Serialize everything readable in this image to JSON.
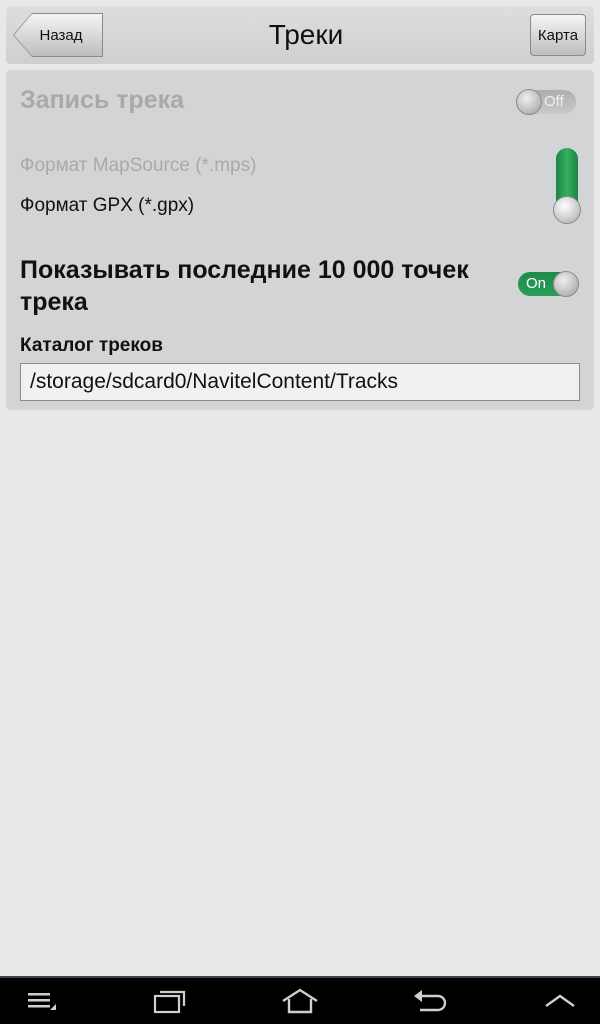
{
  "header": {
    "back_label": "Назад",
    "title": "Треки",
    "map_label": "Карта"
  },
  "settings": {
    "record_track_label": "Запись трека",
    "record_toggle_state": "Off",
    "format_mapsource": "Формат MapSource (*.mps)",
    "format_gpx": "Формат GPX (*.gpx)",
    "selected_format": "GPX",
    "show_last_points_label": "Показывать последние 10 000 точек трека",
    "show_last_toggle_state": "On",
    "catalog_label": "Каталог треков",
    "catalog_value": "/storage/sdcard0/NavitelContent/Tracks"
  },
  "colors": {
    "toggle_on": "#239552",
    "disabled_text": "#a8a9ab",
    "panel_bg": "#d3d4d6"
  },
  "navbar": {
    "icons": [
      "menu-icon",
      "recent-apps-icon",
      "home-icon",
      "back-icon",
      "chevron-up-icon"
    ]
  }
}
